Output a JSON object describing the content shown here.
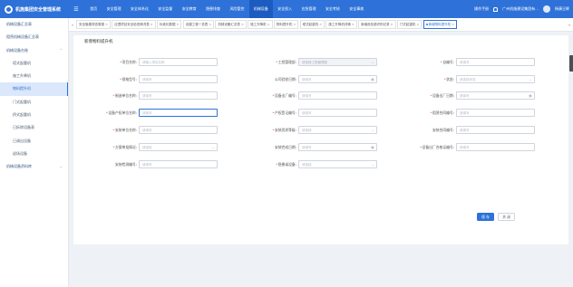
{
  "app": {
    "title": "机施集团安全管理系统"
  },
  "topnav": {
    "home_icon": "menu-icon",
    "items": [
      "首页",
      "安全管理",
      "安全体系化",
      "安全监督",
      "安全教育",
      "隐患排查",
      "风险管控",
      "机械设备",
      "安全投入",
      "应急管理",
      "安全考核",
      "安全事故"
    ],
    "active": "机械设备"
  },
  "user": {
    "manual": "操作手册",
    "company": "广州机施建设集团有...",
    "name": "杨康旦辉"
  },
  "sidebar": {
    "items": [
      {
        "label": "机械设备汇总表",
        "sub": false,
        "expanded": false,
        "active": false
      },
      {
        "label": "租赁机械设备汇总表",
        "sub": false,
        "expanded": false,
        "active": false
      },
      {
        "label": "机械设备台账",
        "sub": false,
        "expanded": true,
        "active": false
      },
      {
        "label": "塔式起重机",
        "sub": true,
        "active": false
      },
      {
        "label": "施工升降机",
        "sub": true,
        "active": false
      },
      {
        "label": "物料提升机",
        "sub": true,
        "active": true
      },
      {
        "label": "门式起重机",
        "sub": true,
        "active": false
      },
      {
        "label": "桥式起重机",
        "sub": true,
        "active": false
      },
      {
        "label": "已拆除设备表",
        "sub": true,
        "active": false
      },
      {
        "label": "已调出设备",
        "sub": true,
        "active": false
      },
      {
        "label": "退场设备",
        "sub": true,
        "active": false
      },
      {
        "label": "机械设备资料库",
        "sub": false,
        "expanded": false,
        "active": false
      }
    ]
  },
  "tabs": [
    {
      "label": "安全隐患排查周报",
      "active": false
    },
    {
      "label": "应遵项目安全检查情况表",
      "active": false
    },
    {
      "label": "标准化数据",
      "active": false
    },
    {
      "label": "设建工程一览表",
      "active": false
    },
    {
      "label": "机械设备汇总表",
      "active": false
    },
    {
      "label": "施工升降机",
      "active": false
    },
    {
      "label": "物料提升机",
      "active": false
    },
    {
      "label": "塔式起重机",
      "active": false
    },
    {
      "label": "施工升降机详情",
      "active": false
    },
    {
      "label": "新增危险源识别记录",
      "active": false
    },
    {
      "label": "门式起重机",
      "active": false
    },
    {
      "label": "新增物料提升机",
      "active": true
    }
  ],
  "form": {
    "title": "新增物料提升机",
    "fields": [
      {
        "id": "project-name",
        "label": "项目名称:",
        "required": true,
        "placeholder": "请输入项目名称",
        "kind": "text"
      },
      {
        "id": "project-manager-dept",
        "label": "工程管理部:",
        "required": true,
        "placeholder": "请选择工程管理部",
        "kind": "select",
        "disabled": true
      },
      {
        "id": "self-number",
        "label": "自编号:",
        "required": true,
        "placeholder": "请填写",
        "kind": "text"
      },
      {
        "id": "spec-model",
        "label": "规格型号:",
        "required": true,
        "placeholder": "请填写",
        "kind": "text"
      },
      {
        "id": "company-entry-date",
        "label": "公司验收日期:",
        "required": false,
        "placeholder": "请填写",
        "kind": "date"
      },
      {
        "id": "status",
        "label": "状态:",
        "required": true,
        "placeholder": "请选择状态",
        "kind": "select"
      },
      {
        "id": "manufacturer",
        "label": "制造单位名称:",
        "required": true,
        "placeholder": "请填写",
        "kind": "text"
      },
      {
        "id": "factory-number",
        "label": "设备出厂编号:",
        "required": true,
        "placeholder": "请填写",
        "kind": "text"
      },
      {
        "id": "factory-date",
        "label": "设备出厂日期:",
        "required": true,
        "placeholder": "请填写",
        "kind": "date"
      },
      {
        "id": "owner-name",
        "label": "设备产权单位名称:",
        "required": true,
        "placeholder": "请填写",
        "kind": "text",
        "focused": true
      },
      {
        "id": "property-cert-number",
        "label": "产权登记编号:",
        "required": true,
        "placeholder": "请填写",
        "kind": "text"
      },
      {
        "id": "lease-contract-number",
        "label": "租赁合同编号:",
        "required": true,
        "placeholder": "请填写",
        "kind": "text"
      },
      {
        "id": "install-unit",
        "label": "安装单位名称:",
        "required": true,
        "placeholder": "请填写",
        "kind": "text"
      },
      {
        "id": "install-qualification",
        "label": "安装资质等级:",
        "required": true,
        "placeholder": "请选择",
        "kind": "select"
      },
      {
        "id": "install-contract-number",
        "label": "安装合同编号:",
        "required": false,
        "placeholder": "请填写",
        "kind": "text"
      },
      {
        "id": "plan-review",
        "label": "方案审批情况:",
        "required": true,
        "placeholder": "请选择",
        "kind": "select"
      },
      {
        "id": "install-complete-date",
        "label": "安装完成日期:",
        "required": false,
        "placeholder": "请填写",
        "kind": "date"
      },
      {
        "id": "factory-cert-number",
        "label": "设备出厂合格证编号:",
        "required": true,
        "placeholder": "请填写",
        "kind": "text"
      },
      {
        "id": "install-inspection-number",
        "label": "安装检测编号:",
        "required": false,
        "placeholder": "请填写",
        "kind": "text"
      },
      {
        "id": "hidden-risk-level",
        "label": "隐患或设备:",
        "required": true,
        "placeholder": "请选择",
        "kind": "select"
      }
    ],
    "buttons": {
      "save": "保 存",
      "close": "关 闭"
    }
  }
}
